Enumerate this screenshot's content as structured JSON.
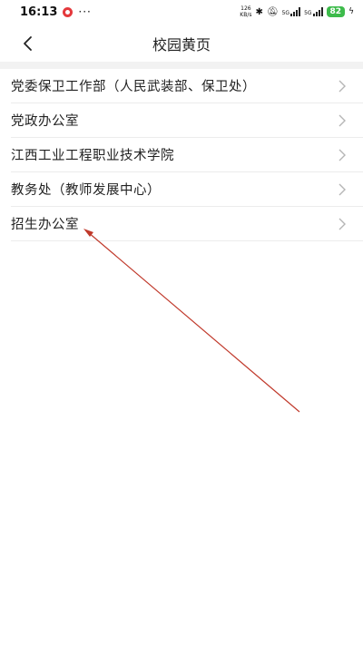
{
  "status_bar": {
    "time": "16:13",
    "dots": "···",
    "speed_value": "126",
    "speed_unit": "KB/s",
    "network_1": "5G",
    "network_2": "5G",
    "battery": "82"
  },
  "header": {
    "title": "校园黄页"
  },
  "list": {
    "items": [
      {
        "label": "党委保卫工作部（人民武装部、保卫处）"
      },
      {
        "label": "党政办公室"
      },
      {
        "label": "江西工业工程职业技术学院"
      },
      {
        "label": "教务处（教师发展中心）"
      },
      {
        "label": "招生办公室"
      }
    ]
  },
  "colors": {
    "annotation_arrow": "#c0392b",
    "battery": "#3dbb4b",
    "divider": "#f2f2f2"
  },
  "icons": {
    "back": "chevron-left-icon",
    "row_chevron": "chevron-right-icon"
  }
}
